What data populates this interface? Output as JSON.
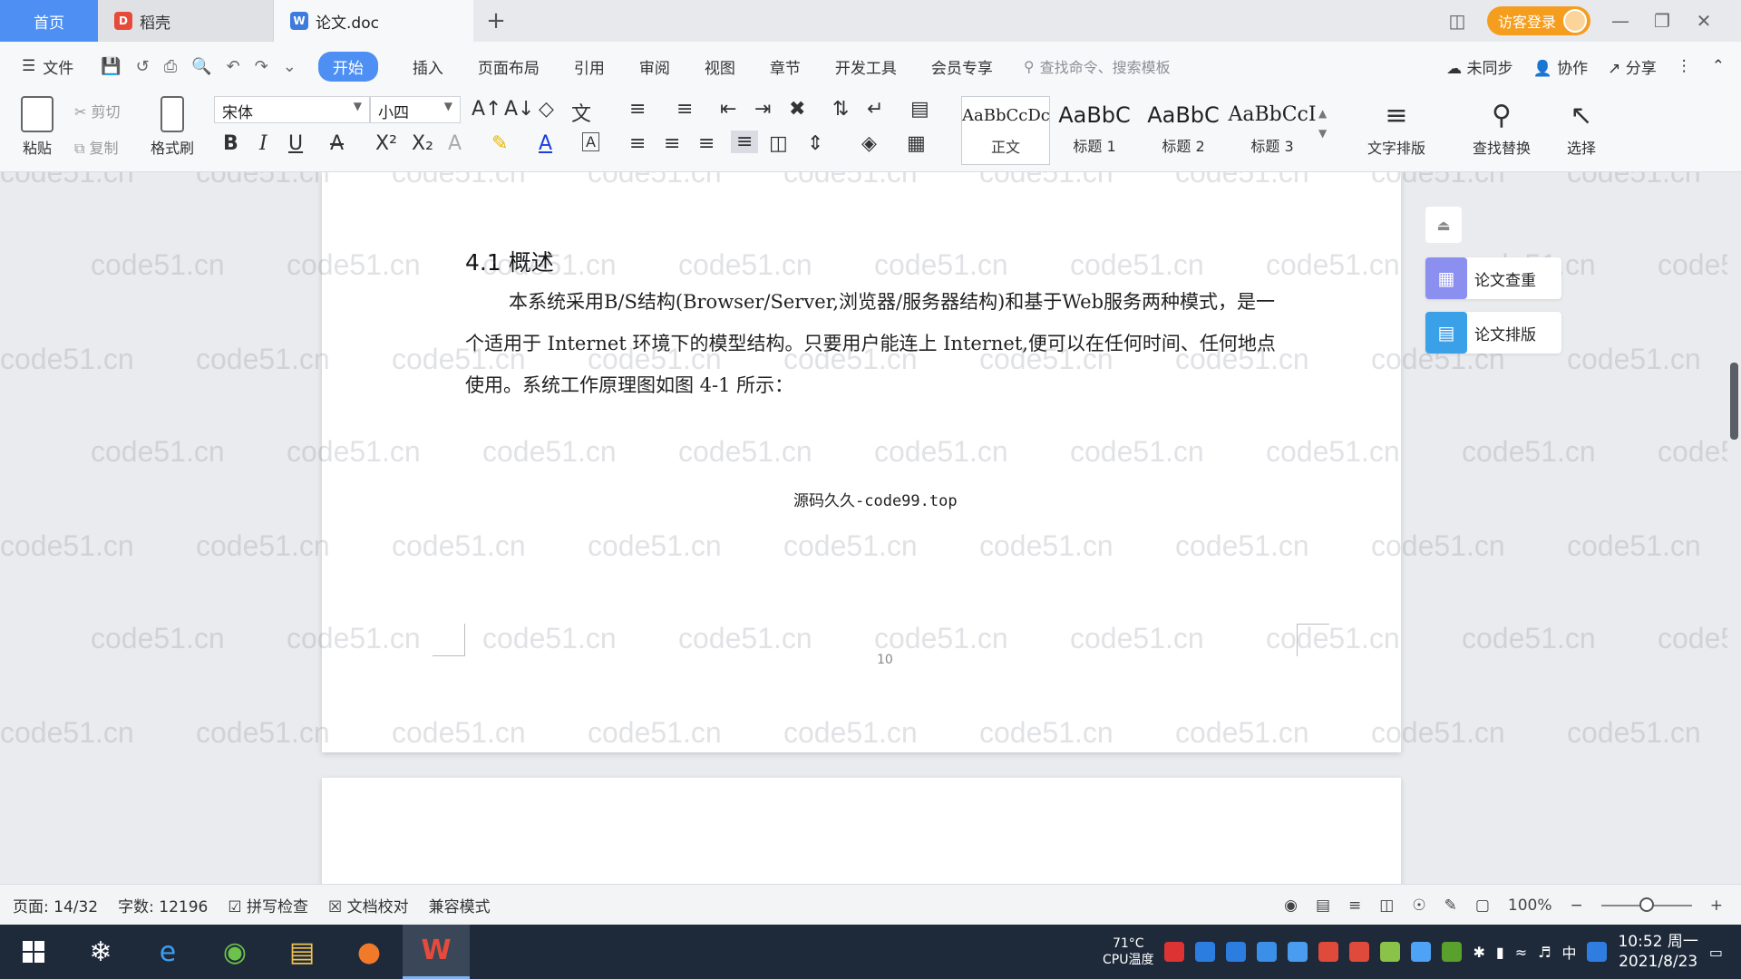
{
  "tabs": {
    "home": "首页",
    "daoke": "稻壳",
    "doc": "论文.doc",
    "add": "+"
  },
  "titlebar": {
    "login": "访客登录"
  },
  "menu": {
    "file": "文件",
    "items": [
      "开始",
      "插入",
      "页面布局",
      "引用",
      "审阅",
      "视图",
      "章节",
      "开发工具",
      "会员专享"
    ],
    "search_placeholder": "查找命令、搜索模板",
    "sync": "未同步",
    "collab": "协作",
    "share": "分享"
  },
  "ribbon": {
    "paste": "粘贴",
    "cut": "剪切",
    "copy": "复制",
    "format_painter": "格式刷",
    "font_name": "宋体",
    "font_size": "小四",
    "styles": [
      {
        "preview": "AaBbCcDc",
        "label": "正文"
      },
      {
        "preview": "AaBbC",
        "label": "标题 1"
      },
      {
        "preview": "AaBbC",
        "label": "标题 2"
      },
      {
        "preview": "AaBbCcI",
        "label": "标题 3"
      }
    ],
    "text_layout": "文字排版",
    "find_replace": "查找替换",
    "select": "选择"
  },
  "document": {
    "heading": "4.1 概述",
    "paragraph": "本系统采用B/S结构(Browser/Server,浏览器/服务器结构)和基于Web服务两种模式，是一个适用于 Internet 环境下的模型结构。只要用户能连上 Internet,便可以在任何时间、任何地点使用。系统工作原理图如图 4-1 所示：",
    "caption": "源码久久-code99.top",
    "page_number": "10",
    "watermark": "code51.cn"
  },
  "side_panel": {
    "check": "论文查重",
    "layout": "论文排版"
  },
  "status": {
    "page": "页面: 14/32",
    "words": "字数: 12196",
    "spell": "拼写检查",
    "proof": "文档校对",
    "compat": "兼容模式",
    "zoom": "100%",
    "zoom_level": 0.5
  },
  "taskbar": {
    "cpu_temp": "71°C",
    "cpu_label": "CPU温度",
    "ime": "中",
    "time": "10:52 周一",
    "date": "2021/8/23"
  }
}
